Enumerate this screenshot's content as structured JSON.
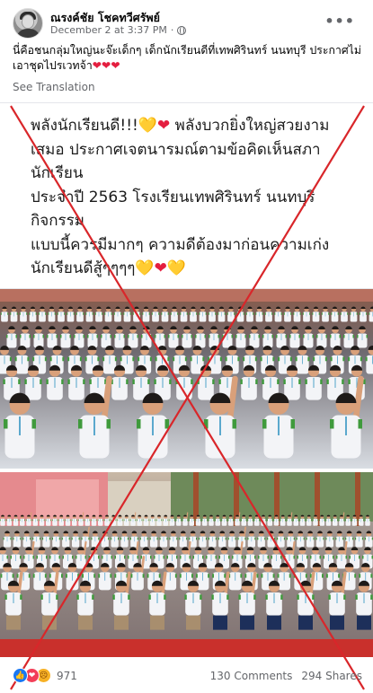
{
  "post": {
    "author": "ณรงค์ชัย โชคทวีศรัพย์",
    "date": "December 2 at 3:37 PM",
    "separator": "·",
    "more": "•••",
    "caption": "นี่คือชนกลุ่มใหญ่นะจ๊ะเด็กๆ เด็กนักเรียนดีที่เทพศิรินทร์  นนทบุรี ประกาศไม่เอาชุดไปรเวทจ้า",
    "caption_hearts": "❤❤❤",
    "see_translation": "See Translation"
  },
  "shared_text": {
    "line1": "พลังนักเรียนดี!!!",
    "line1_heart1": "💛",
    "line1_heart2": "❤",
    "line1_rest": " พลังบวกยิ่งใหญ่สวยงาม",
    "line2": "เสมอ ประกาศเจตนารมณ์ตามข้อคิดเห็นสภา",
    "line3": "นักเรียน",
    "line4": "ประจำปี 2563 โรงเรียนเทพศิรินทร์ นนทบุรี",
    "line5": "กิจกรรม",
    "line6": "แบบนี้ควรมีมากๆ ความดีต้องมาก่อนความเก่ง",
    "line7": "นักเรียนดีสู้ๆๆๆๆ",
    "line7_heart1": "💛",
    "line7_heart2": "❤",
    "line7_heart3": "💛"
  },
  "footer": {
    "reaction_count": "971",
    "comments": "130 Comments",
    "shares": "294 Shares",
    "reactions": [
      "like",
      "love",
      "angry"
    ]
  },
  "colors": {
    "cross": "#d9262a",
    "like": "#1877f2",
    "love": "#f33e58",
    "angry": "#f7b125",
    "meta": "#65676b"
  }
}
